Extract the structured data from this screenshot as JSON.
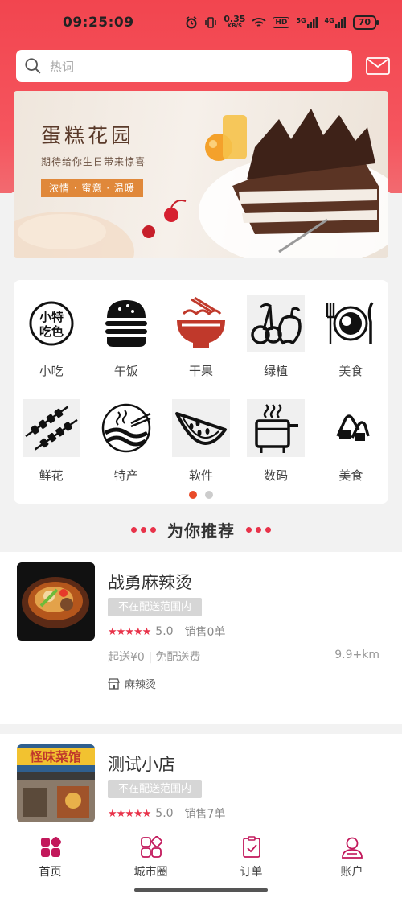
{
  "status_bar": {
    "time": "09:25:09",
    "speed_value": "0.35",
    "speed_unit": "KB/S",
    "hd_label": "HD",
    "signal1": "5G",
    "signal2": "4G",
    "battery": "70",
    "icons": [
      "alarm-icon",
      "vibrate-icon",
      "wifi-icon",
      "signal-icon"
    ]
  },
  "search": {
    "placeholder": "热词"
  },
  "banner": {
    "title": "蛋糕花园",
    "subtitle": "期待给你生日带来惊喜",
    "tag": "浓情 · 蜜意 · 温暖"
  },
  "categories": [
    {
      "label": "小吃",
      "icon": "snack-icon"
    },
    {
      "label": "午饭",
      "icon": "burger-icon"
    },
    {
      "label": "干果",
      "icon": "noodle-bowl-icon"
    },
    {
      "label": "绿植",
      "icon": "cherry-apple-icon"
    },
    {
      "label": "美食",
      "icon": "plate-fork-knife-icon"
    },
    {
      "label": "鲜花",
      "icon": "kebab-icon"
    },
    {
      "label": "特产",
      "icon": "noodle-waves-icon"
    },
    {
      "label": "软件",
      "icon": "watermelon-icon"
    },
    {
      "label": "数码",
      "icon": "pot-icon"
    },
    {
      "label": "美食",
      "icon": "rice-ball-icon"
    }
  ],
  "pager": {
    "pages": 2,
    "active": 0
  },
  "recommend": {
    "title": "为你推荐"
  },
  "shops": [
    {
      "name": "战勇麻辣烫",
      "badge": "不在配送范围内",
      "rating": "5.0",
      "sales": "销售0单",
      "fee": "起送¥0 | 免配送费",
      "distance": "9.9+km",
      "tag": "麻辣烫"
    },
    {
      "name": "测试小店",
      "badge": "不在配送范围内",
      "rating": "5.0",
      "sales": "销售7单"
    }
  ],
  "tabbar": [
    {
      "label": "首页",
      "icon": "home-grid-icon",
      "active": true
    },
    {
      "label": "城市圈",
      "icon": "city-circle-icon",
      "active": false
    },
    {
      "label": "订单",
      "icon": "order-clipboard-icon",
      "active": false
    },
    {
      "label": "账户",
      "icon": "account-person-icon",
      "active": false
    }
  ],
  "colors": {
    "accent": "#e8334a",
    "header": "#f2454f",
    "pager_active": "#e94b29"
  }
}
